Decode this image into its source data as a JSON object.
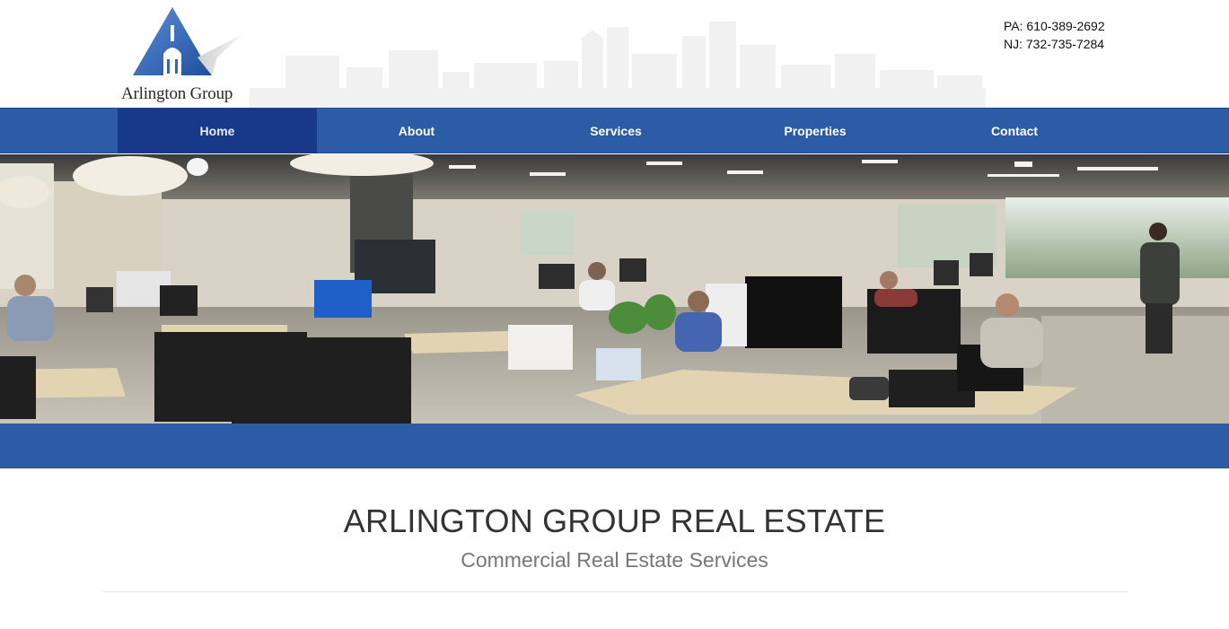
{
  "header": {
    "logo_text": "Arlington Group",
    "phone_pa": "PA: 610-389-2692",
    "phone_nj": "NJ: 732-735-7284"
  },
  "nav": {
    "items": [
      {
        "label": "Home",
        "active": true
      },
      {
        "label": "About",
        "active": false
      },
      {
        "label": "Services",
        "active": false
      },
      {
        "label": "Properties",
        "active": false
      },
      {
        "label": "Contact",
        "active": false
      }
    ]
  },
  "main": {
    "title": "ARLINGTON GROUP REAL ESTATE",
    "subtitle": "Commercial Real Estate Services"
  },
  "colors": {
    "nav_blue": "#2d5ca6",
    "nav_active": "#18398a",
    "logo_blue": "#2f66b8"
  }
}
